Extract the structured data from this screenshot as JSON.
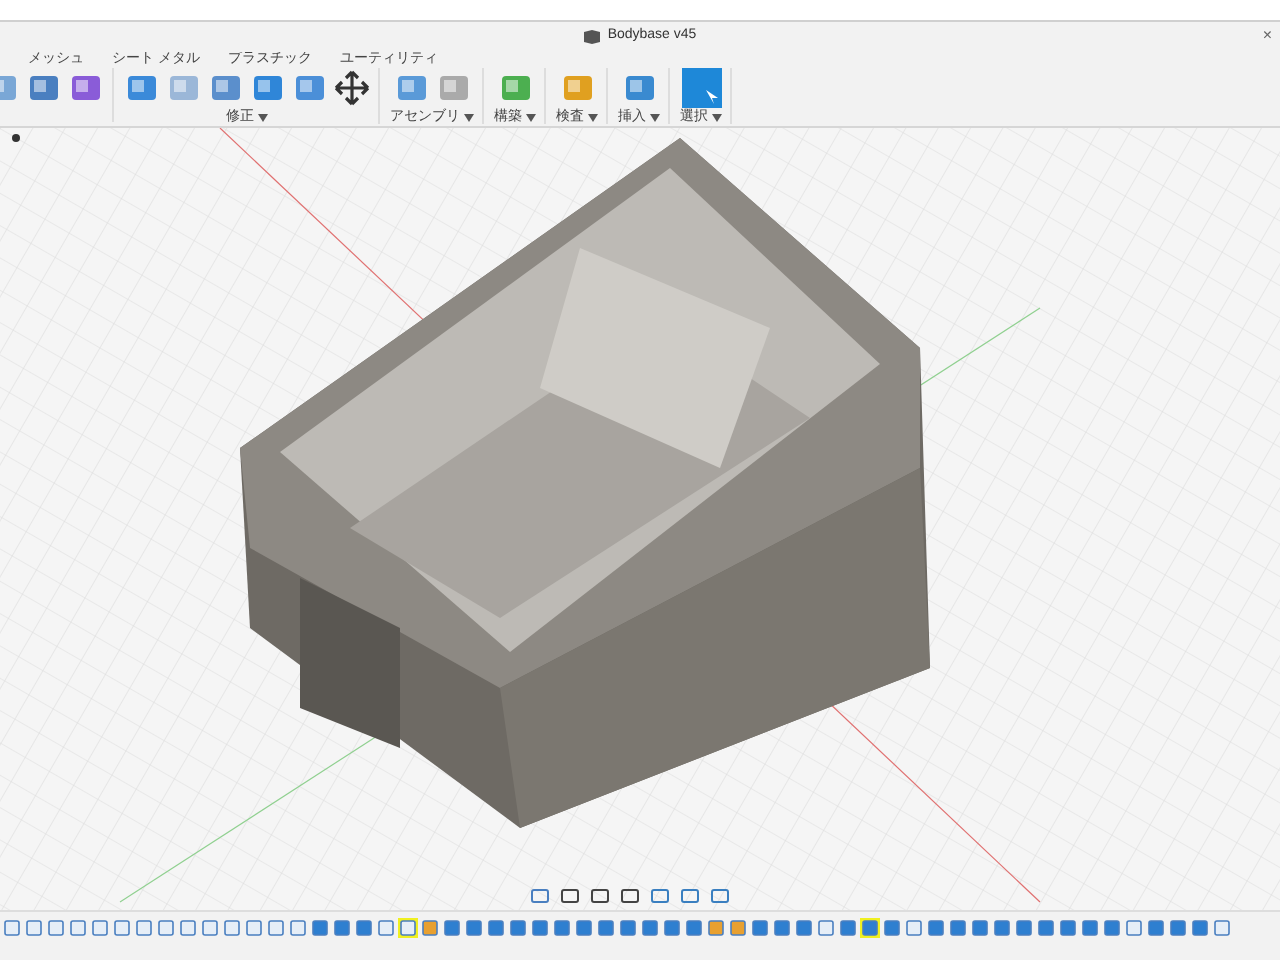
{
  "window": {
    "title": "Bodybase v45",
    "close": "×"
  },
  "tabs": [
    {
      "label": "メッシュ"
    },
    {
      "label": "シート メタル"
    },
    {
      "label": "プラスチック"
    },
    {
      "label": "ユーティリティ"
    }
  ],
  "tool_groups": [
    {
      "tools": [
        {
          "kind": "shell"
        },
        {
          "kind": "points"
        },
        {
          "kind": "sphere"
        }
      ]
    },
    {
      "label": "修正",
      "tools": [
        {
          "kind": "press"
        },
        {
          "kind": "fillet"
        },
        {
          "kind": "face"
        },
        {
          "kind": "combine"
        },
        {
          "kind": "align"
        },
        {
          "kind": "move"
        }
      ]
    },
    {
      "label": "アセンブリ",
      "tools": [
        {
          "kind": "component"
        },
        {
          "kind": "joint"
        }
      ]
    },
    {
      "label": "構築",
      "tools": [
        {
          "kind": "plane"
        }
      ]
    },
    {
      "label": "検査",
      "tools": [
        {
          "kind": "measure"
        }
      ]
    },
    {
      "label": "挿入",
      "tools": [
        {
          "kind": "image"
        }
      ]
    },
    {
      "label": "選択",
      "tools": [
        {
          "kind": "select"
        }
      ]
    }
  ],
  "timeline": [
    {
      "kind": "sketch",
      "selected": false
    },
    {
      "kind": "sketch",
      "selected": false
    },
    {
      "kind": "sketch",
      "selected": false
    },
    {
      "kind": "sketch",
      "selected": false
    },
    {
      "kind": "sketch",
      "selected": false
    },
    {
      "kind": "sketch",
      "selected": false
    },
    {
      "kind": "sketch",
      "selected": false
    },
    {
      "kind": "sketch",
      "selected": false
    },
    {
      "kind": "sketch",
      "selected": false
    },
    {
      "kind": "sketch",
      "selected": false
    },
    {
      "kind": "sketch",
      "selected": false
    },
    {
      "kind": "sketch",
      "selected": false
    },
    {
      "kind": "sketch",
      "selected": false
    },
    {
      "kind": "sketch",
      "selected": false
    },
    {
      "kind": "body",
      "selected": false
    },
    {
      "kind": "body",
      "selected": false
    },
    {
      "kind": "body",
      "selected": false
    },
    {
      "kind": "sketch",
      "selected": false
    },
    {
      "kind": "sketch",
      "selected": true
    },
    {
      "kind": "joint",
      "selected": false
    },
    {
      "kind": "body",
      "selected": false
    },
    {
      "kind": "body",
      "selected": false
    },
    {
      "kind": "body",
      "selected": false
    },
    {
      "kind": "body",
      "selected": false
    },
    {
      "kind": "body",
      "selected": false
    },
    {
      "kind": "body",
      "selected": false
    },
    {
      "kind": "body",
      "selected": false
    },
    {
      "kind": "body",
      "selected": false
    },
    {
      "kind": "body",
      "selected": false
    },
    {
      "kind": "body",
      "selected": false
    },
    {
      "kind": "body",
      "selected": false
    },
    {
      "kind": "body",
      "selected": false
    },
    {
      "kind": "joint",
      "selected": false
    },
    {
      "kind": "joint",
      "selected": false
    },
    {
      "kind": "body",
      "selected": false
    },
    {
      "kind": "body",
      "selected": false
    },
    {
      "kind": "body",
      "selected": false
    },
    {
      "kind": "sketch",
      "selected": false
    },
    {
      "kind": "body",
      "selected": false
    },
    {
      "kind": "body",
      "selected": true
    },
    {
      "kind": "body",
      "selected": false
    },
    {
      "kind": "sketch",
      "selected": false
    },
    {
      "kind": "body",
      "selected": false
    },
    {
      "kind": "body",
      "selected": false
    },
    {
      "kind": "body",
      "selected": false
    },
    {
      "kind": "body",
      "selected": false
    },
    {
      "kind": "body",
      "selected": false
    },
    {
      "kind": "body",
      "selected": false
    },
    {
      "kind": "body",
      "selected": false
    },
    {
      "kind": "body",
      "selected": false
    },
    {
      "kind": "body",
      "selected": false
    },
    {
      "kind": "sketch",
      "selected": false
    },
    {
      "kind": "body",
      "selected": false
    },
    {
      "kind": "body",
      "selected": false
    },
    {
      "kind": "body",
      "selected": false
    },
    {
      "kind": "sketch",
      "selected": false
    }
  ]
}
